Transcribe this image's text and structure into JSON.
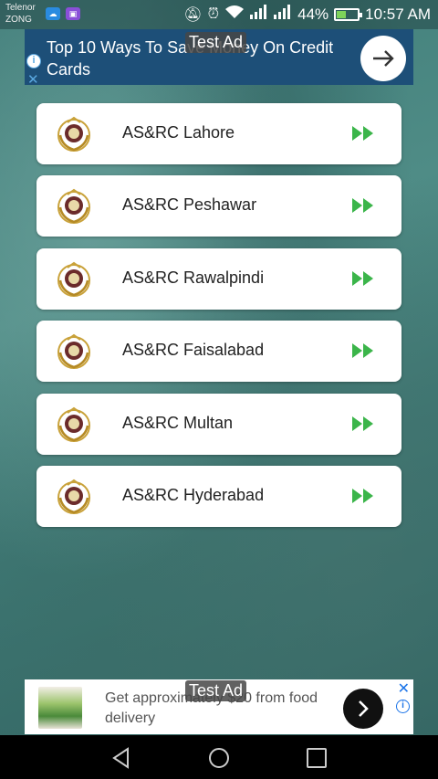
{
  "status_bar": {
    "carrier_1": "Telenor",
    "carrier_2": "ZONG",
    "battery_percent": "44%",
    "battery_level": 0.44,
    "time": "10:57 AM",
    "icons": [
      "mute-icon",
      "alarm-icon",
      "wifi-icon",
      "signal-icon",
      "signal-icon",
      "battery-icon"
    ]
  },
  "top_ad": {
    "text": "Top 10 Ways To Save Money On Credit Cards",
    "label": "Test Ad",
    "accent": "#1d4f78"
  },
  "list": {
    "items": [
      {
        "label": "AS&RC Lahore"
      },
      {
        "label": "AS&RC Peshawar"
      },
      {
        "label": "AS&RC Rawalpindi"
      },
      {
        "label": "AS&RC Faisalabad"
      },
      {
        "label": "AS&RC Multan"
      },
      {
        "label": "AS&RC Hyderabad"
      }
    ],
    "arrow_color": "#3bb54a"
  },
  "bottom_ad": {
    "text": "Get approximately $20 from food delivery",
    "label": "Test Ad"
  },
  "nav_bar": {
    "icons": [
      "back-icon",
      "home-icon",
      "recents-icon"
    ]
  }
}
